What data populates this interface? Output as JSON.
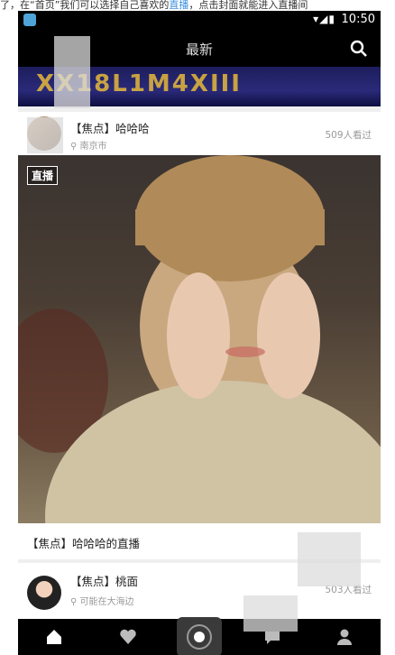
{
  "top_caption": {
    "before": "了，在“首页”我们可以选择自己喜欢的",
    "link": "直播",
    "after": "，点击封面就能进入直播间"
  },
  "status_bar": {
    "time": "10:50",
    "icons": "▾◢▮"
  },
  "header": {
    "title": "最新"
  },
  "banner": {
    "text": "XX18L1M4XIII"
  },
  "feed": [
    {
      "name": "【焦点】哈哈哈",
      "location": "南京市",
      "viewers": "509人看过"
    },
    {
      "name": "【焦点】桃面",
      "location": "可能在大海边",
      "viewers": "503人看过"
    }
  ],
  "live": {
    "badge": "直播",
    "caption": "【焦点】哈哈哈的直播"
  },
  "tabs": [
    "home-icon",
    "heart-icon",
    "live-camera-icon",
    "message-icon",
    "profile-icon"
  ],
  "colors": {
    "link": "#3b8fe0",
    "bar": "#000000",
    "banner": "#2a2a7a"
  }
}
